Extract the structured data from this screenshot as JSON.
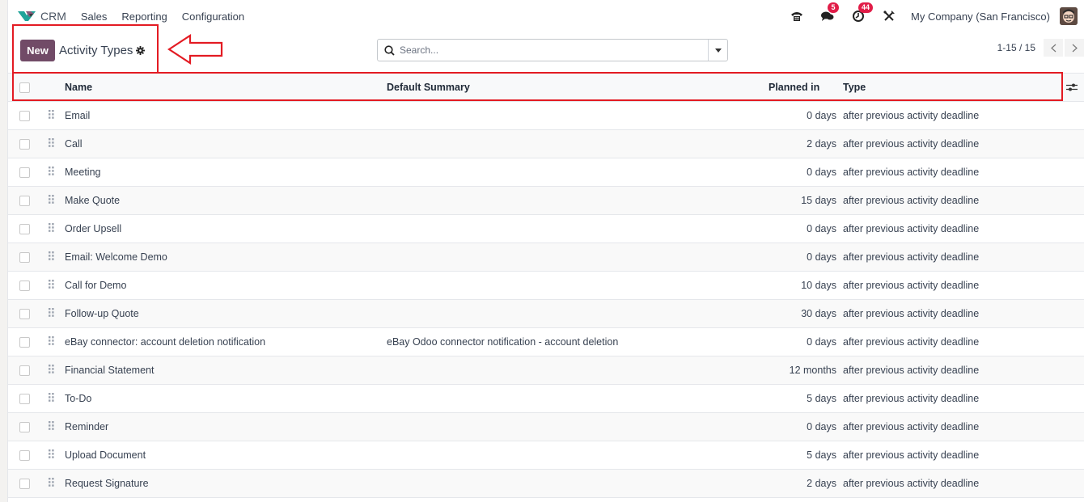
{
  "navbar": {
    "app_name": "CRM",
    "menu": [
      "Sales",
      "Reporting",
      "Configuration"
    ],
    "icons": [
      {
        "name": "phone-icon",
        "badge": null
      },
      {
        "name": "chat-icon",
        "badge": "5"
      },
      {
        "name": "clock-activity-icon",
        "badge": "44"
      },
      {
        "name": "tools-icon",
        "badge": null
      }
    ],
    "company": "My Company (San Francisco)"
  },
  "control": {
    "new_label": "New",
    "title": "Activity Types",
    "search_placeholder": "Search...",
    "pager": "1-15 / 15"
  },
  "colors": {
    "brand": "#714b67",
    "badge": "#e11d48",
    "annotation": "#e31b23"
  },
  "table": {
    "columns": [
      "Name",
      "Default Summary",
      "Planned in",
      "Type"
    ],
    "rows": [
      {
        "name": "Email",
        "summary": "",
        "planned": "0 days",
        "type": "after previous activity deadline"
      },
      {
        "name": "Call",
        "summary": "",
        "planned": "2 days",
        "type": "after previous activity deadline"
      },
      {
        "name": "Meeting",
        "summary": "",
        "planned": "0 days",
        "type": "after previous activity deadline"
      },
      {
        "name": "Make Quote",
        "summary": "",
        "planned": "15 days",
        "type": "after previous activity deadline"
      },
      {
        "name": "Order Upsell",
        "summary": "",
        "planned": "0 days",
        "type": "after previous activity deadline"
      },
      {
        "name": "Email: Welcome Demo",
        "summary": "",
        "planned": "0 days",
        "type": "after previous activity deadline"
      },
      {
        "name": "Call for Demo",
        "summary": "",
        "planned": "10 days",
        "type": "after previous activity deadline"
      },
      {
        "name": "Follow-up Quote",
        "summary": "",
        "planned": "30 days",
        "type": "after previous activity deadline"
      },
      {
        "name": "eBay connector: account deletion notification",
        "summary": "eBay Odoo connector notification - account deletion",
        "planned": "0 days",
        "type": "after previous activity deadline"
      },
      {
        "name": "Financial Statement",
        "summary": "",
        "planned": "12 months",
        "type": "after previous activity deadline"
      },
      {
        "name": "To-Do",
        "summary": "",
        "planned": "5 days",
        "type": "after previous activity deadline"
      },
      {
        "name": "Reminder",
        "summary": "",
        "planned": "0 days",
        "type": "after previous activity deadline"
      },
      {
        "name": "Upload Document",
        "summary": "",
        "planned": "5 days",
        "type": "after previous activity deadline"
      },
      {
        "name": "Request Signature",
        "summary": "",
        "planned": "2 days",
        "type": "after previous activity deadline"
      }
    ]
  }
}
